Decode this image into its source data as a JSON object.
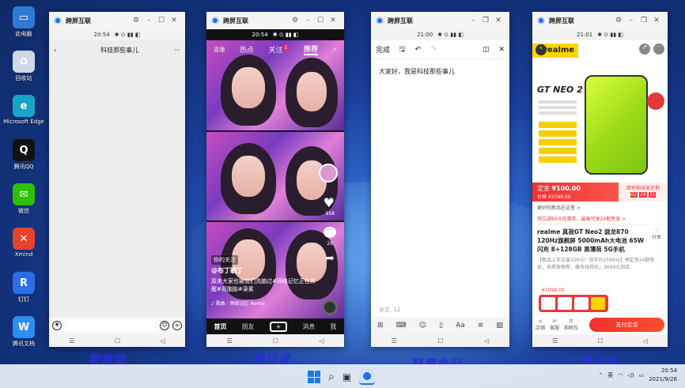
{
  "desktop_icons": [
    {
      "label": "此电脑",
      "color": "#2f7bd8",
      "glyph": "▭"
    },
    {
      "label": "回收站",
      "color": "#cfd8e6",
      "glyph": "♻"
    },
    {
      "label": "Microsoft Edge",
      "color": "#1aa3c8",
      "glyph": "e"
    },
    {
      "label": "腾讯QQ",
      "color": "#111",
      "glyph": "Q"
    },
    {
      "label": "微信",
      "color": "#2ec100",
      "glyph": "✉"
    },
    {
      "label": "Xmind",
      "color": "#e8432a",
      "glyph": "✕"
    },
    {
      "label": "钉钉",
      "color": "#2a6ee8",
      "glyph": "R"
    },
    {
      "label": "腾讯文档",
      "color": "#2f8cf0",
      "glyph": "W"
    }
  ],
  "captions": {
    "c1": "聊微信",
    "c2": "刷抖音",
    "c3": "轻度办公",
    "c4": "逛京东"
  },
  "app_name": "跨屏互联",
  "win1": {
    "time": "20:54",
    "chat_title": "科技那些事儿",
    "more": "···"
  },
  "win2": {
    "time": "20:54",
    "tabs": [
      "直播",
      "热点",
      "关注",
      "推荐"
    ],
    "live_badge": "直播",
    "attention_badge": "1",
    "like_count": "958",
    "comment_count": "26",
    "tag": "你的关注",
    "user": "@布丁歌丁",
    "desc": "原来大家也被我们洗脑过#网络记忆正在苏醒#双胞胎#录素",
    "music": "♪ 歌曲 · 网络记忆 Remix",
    "nav": [
      "首页",
      "朋友",
      "+",
      "消息",
      "我"
    ]
  },
  "win3": {
    "time": "21:00",
    "done": "完成",
    "content": "大家好，我是科技那些事儿",
    "wordcount": "全文: 12"
  },
  "win4": {
    "time": "21:01",
    "brand": "realme",
    "model": "GT NEO 2",
    "deposit": "定金",
    "price": "¥100.00",
    "orig": "价格 ¥2599.00",
    "countdown_label": "距抢购结束还剩",
    "countdown": [
      "02",
      "28",
      "31"
    ],
    "notice": "更好的新品在这里 >",
    "coupon": "领立减60元优惠券，最高可享24期免息 >",
    "product_title": "realme 真我GT Neo2 骁龙870 120Hz旗舰屏 5000mAh大电池 65W闪充 8+128GB 黑薄荷 5G手机",
    "share": "分享",
    "promo": "【新品上市立省100元！到手价2599元】预定享24期免息，非质保换新，赠有线耳机；3699元到店",
    "buy": "支付定金",
    "shop": "店铺",
    "kefu": "客服",
    "cart": "购物车",
    "tiny_price": "¥1099.00"
  },
  "taskbar": {
    "time": "20:54",
    "date": "2021/9/26",
    "lang": "英"
  }
}
